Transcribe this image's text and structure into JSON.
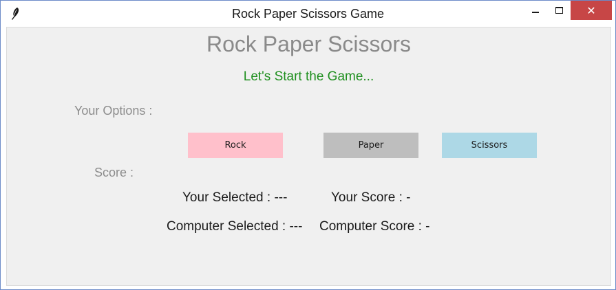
{
  "window": {
    "title": "Rock Paper Scissors Game",
    "icon": "feather-icon",
    "controls": {
      "minimize": "minimize-icon",
      "maximize": "maximize-icon",
      "close": "close-icon",
      "close_glyph": "✕"
    }
  },
  "main": {
    "heading": "Rock Paper Scissors",
    "subheading": "Let's Start the Game...",
    "options_label": "Your Options :",
    "score_label": "Score :"
  },
  "buttons": [
    {
      "label": "Rock",
      "color": "#ffc0cb"
    },
    {
      "label": "Paper",
      "color": "#bebebe"
    },
    {
      "label": "Scissors",
      "color": "#add8e6"
    }
  ],
  "results": {
    "your_selected": "Your Selected : ---",
    "your_score": "Your Score : -",
    "computer_selected": "Computer Selected : ---",
    "computer_score": "Computer Score : -"
  },
  "colors": {
    "heading": "#8a8a8a",
    "subheading": "#1f8f1f",
    "close_button": "#c74646",
    "client_background": "#f0f0f0"
  }
}
